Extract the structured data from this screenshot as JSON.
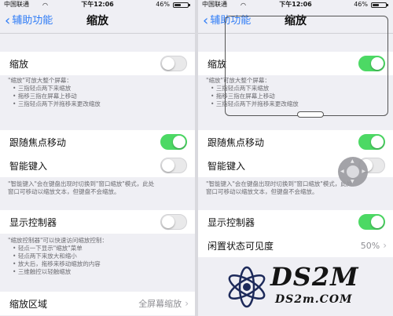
{
  "left": {
    "status": {
      "carrier": "中国联通",
      "time": "下午12:06",
      "battery": "46%",
      "battery_level": 0.46
    },
    "nav": {
      "back": "辅助功能",
      "title": "缩放"
    },
    "zoom": {
      "label": "缩放",
      "on": false
    },
    "zoom_desc": {
      "intro": "\"缩放\"可放大整个屏幕：",
      "items": [
        "三指轻点两下来缩放",
        "拖移三指在屏幕上移动",
        "三指轻点两下并拖移来更改缩放"
      ]
    },
    "follow_focus": {
      "label": "跟随焦点移动",
      "on": true
    },
    "smart_typing": {
      "label": "智能键入",
      "on": false
    },
    "smart_desc": {
      "lines": [
        "\"智能键入\"会在键盘出现时切换到\"窗口缩放\"模式，此处",
        "窗口可移动以缩放文本，但键盘不会缩放。"
      ]
    },
    "show_controller": {
      "label": "显示控制器",
      "on": false
    },
    "controller_desc": {
      "intro": "\"缩放控制器\"可以快速访问缩放控制：",
      "items": [
        "轻点一下显示\"缩放\"菜单",
        "轻点两下来放大和缩小",
        "放大后，拖移来移动缩放的内容",
        "三维触控以轻触缩放"
      ]
    },
    "zoom_region": {
      "label": "缩放区域",
      "value": "全屏幕缩放"
    }
  },
  "right": {
    "status": {
      "carrier": "中国联通",
      "time": "下午12:06",
      "battery": "46%",
      "battery_level": 0.46
    },
    "nav": {
      "back": "辅助功能",
      "title": "缩放"
    },
    "zoom": {
      "label": "缩放",
      "on": true
    },
    "zoom_desc": {
      "intro": "\"缩放\"可放大整个屏幕：",
      "items": [
        "三指轻点两下来缩放",
        "拖移三指在屏幕上移动",
        "三指轻点两下并拖移来更改缩放"
      ]
    },
    "follow_focus": {
      "label": "跟随焦点移动",
      "on": true
    },
    "smart_typing": {
      "label": "智能键入",
      "on": false
    },
    "smart_desc": {
      "lines": [
        "\"智能键入\"会在键盘出现时切换到\"窗口缩放\"模式，此处",
        "窗口可移动以缩放文本，但键盘不会缩放。"
      ]
    },
    "show_controller": {
      "label": "显示控制器",
      "on": true
    },
    "idle_visibility": {
      "label": "闲置状态可见度",
      "value": "50%"
    }
  },
  "watermark": {
    "brand": "DS2M",
    "url": "DS2m.COM"
  },
  "colors": {
    "accent": "#2f7cf6",
    "toggle_on": "#4cd964",
    "group_bg": "#efeff4"
  }
}
